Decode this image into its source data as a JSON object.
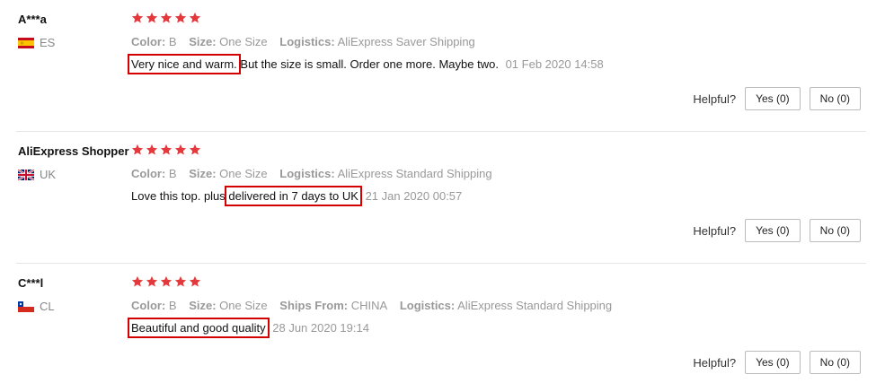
{
  "colors": {
    "star": "#e4393c",
    "highlight": "#d40000"
  },
  "reviews": [
    {
      "name": "A***a",
      "country": "ES",
      "flag_icon": "spain-flag-icon",
      "rating": 5,
      "attrs": {
        "color_label": "Color:",
        "color": "B",
        "size_label": "Size:",
        "size": "One Size",
        "logistics_label": "Logistics:",
        "logistics": "AliExpress Saver Shipping"
      },
      "text_highlight": "Very nice and warm.",
      "text_rest": " But the size is small. Order one more. Maybe two.",
      "date": "01 Feb 2020 14:58",
      "helpful_label": "Helpful?",
      "yes_label": "Yes (0)",
      "no_label": "No (0)"
    },
    {
      "name": "AliExpress Shopper",
      "country": "UK",
      "flag_icon": "uk-flag-icon",
      "rating": 5,
      "attrs": {
        "color_label": "Color:",
        "color": "B",
        "size_label": "Size:",
        "size": "One Size",
        "logistics_label": "Logistics:",
        "logistics": "AliExpress Standard Shipping"
      },
      "text_pre": "Love this top. plus ",
      "text_highlight": "delivered in 7 days to UK",
      "date": "21 Jan 2020 00:57",
      "helpful_label": "Helpful?",
      "yes_label": "Yes (0)",
      "no_label": "No (0)"
    },
    {
      "name": "C***l",
      "country": "CL",
      "flag_icon": "chile-flag-icon",
      "rating": 5,
      "attrs": {
        "color_label": "Color:",
        "color": "B",
        "size_label": "Size:",
        "size": "One Size",
        "ships_label": "Ships From:",
        "ships": "CHINA",
        "logistics_label": "Logistics:",
        "logistics": "AliExpress Standard Shipping"
      },
      "text_highlight": "Beautiful and good quality",
      "date": "28 Jun 2020 19:14",
      "helpful_label": "Helpful?",
      "yes_label": "Yes (0)",
      "no_label": "No (0)"
    }
  ]
}
